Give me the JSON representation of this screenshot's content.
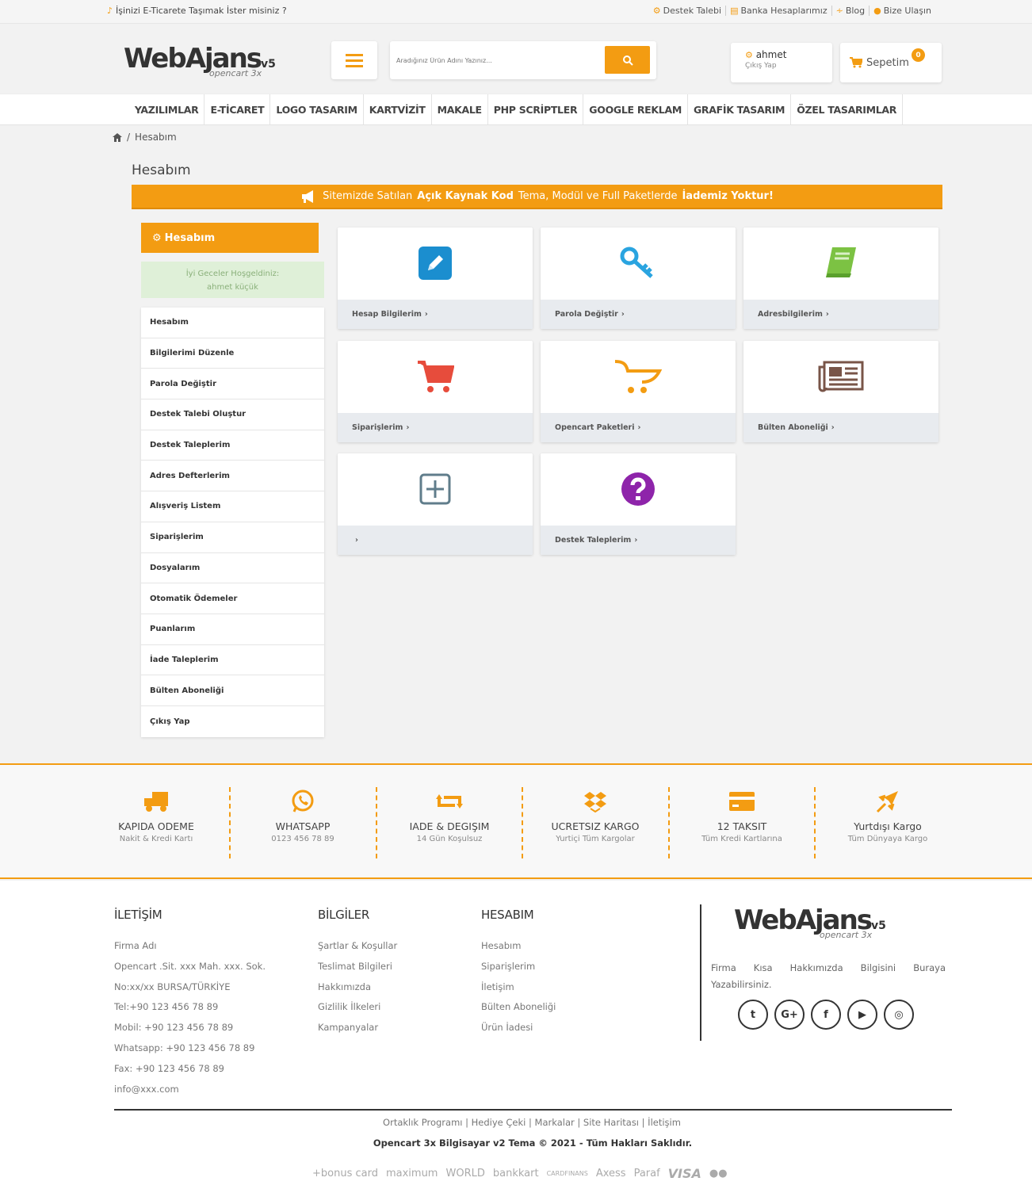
{
  "topbar": {
    "promo": "İşinizi E-Ticarete Taşımak İster misiniz ?",
    "links": [
      "Destek Talebi",
      "Banka Hesaplarımız",
      "Blog",
      "Bize Ulaşın"
    ]
  },
  "header": {
    "logo_main": "WebAjans",
    "logo_version": "v5",
    "logo_sub": "opencart 3x",
    "search_placeholder": "Aradığınız Ürün Adını Yazınız...",
    "account_name": "ahmet",
    "account_sub": "Çıkış Yap",
    "cart_label": "Sepetim",
    "cart_count": "0"
  },
  "nav": [
    "YAZILIMLAR",
    "E-TİCARET",
    "LOGO TASARIM",
    "KARTVİZİT",
    "MAKALE",
    "PHP SCRİPTLER",
    "GOOGLE REKLAM",
    "GRAFİK TASARIM",
    "ÖZEL TASARIMLAR"
  ],
  "breadcrumb": {
    "sep": "/",
    "current": "Hesabım"
  },
  "page_title": "Hesabım",
  "banner": {
    "part1": "Sitemizde Satılan",
    "bold1": "Açık Kaynak Kod",
    "part2": "Tema, Modül ve Full Paketlerde",
    "bold2": "İademiz Yoktur!"
  },
  "sidebar": {
    "title": "Hesabım",
    "welcome_line1": "İyi Geceler Hoşgeldiniz:",
    "welcome_line2": "ahmet küçük",
    "items": [
      "Hesabım",
      "Bilgilerimi Düzenle",
      "Parola Değiştir",
      "Destek Talebi Oluştur",
      "Destek Taleplerim",
      "Adres Defterlerim",
      "Alışveriş Listem",
      "Siparişlerim",
      "Dosyalarım",
      "Otomatik Ödemeler",
      "Puanlarım",
      "İade Taleplerim",
      "Bülten Aboneliği",
      "Çıkış Yap"
    ]
  },
  "cards": [
    {
      "label": "Hesap Bilgilerim",
      "icon": "edit-icon",
      "color": "#1b8ecf"
    },
    {
      "label": "Parola Değiştir",
      "icon": "key-icon",
      "color": "#2aa4e0"
    },
    {
      "label": "Adresbilgilerim",
      "icon": "book-icon",
      "color": "#7cc243"
    },
    {
      "label": "Siparişlerim",
      "icon": "cart-icon",
      "color": "#e74c3c"
    },
    {
      "label": "Opencart Paketleri",
      "icon": "opencart-cart-icon",
      "color": "#f39c12"
    },
    {
      "label": "Bülten Aboneliği",
      "icon": "newspaper-icon",
      "color": "#795548"
    },
    {
      "label": "",
      "icon": "plus-square-icon",
      "color": "#607d8b"
    },
    {
      "label": "Destek Taleplerim",
      "icon": "question-circle-icon",
      "color": "#8e24aa"
    }
  ],
  "features": [
    {
      "title": "KAPIDA ODEME",
      "sub": "Nakit & Kredi Kartı"
    },
    {
      "title": "WHATSAPP",
      "sub": "0123 456 78 89"
    },
    {
      "title": "IADE & DEGIŞIM",
      "sub": "14 Gün Koşulsuz"
    },
    {
      "title": "UCRETSIZ KARGO",
      "sub": "Yurtiçi Tüm Kargolar"
    },
    {
      "title": "12 TAKSIT",
      "sub": "Tüm Kredi Kartlarına"
    },
    {
      "title": "Yurtdışı Kargo",
      "sub": "Tüm Dünyaya Kargo"
    }
  ],
  "footer": {
    "contact_title": "İLETİŞİM",
    "contact": [
      "Firma Adı",
      "Opencart .Sit. xxx Mah. xxx. Sok.",
      "No:xx/xx BURSA/TÜRKİYE",
      "Tel:+90 123 456 78 89",
      "Mobil: +90 123 456 78 89",
      "Whatsapp: +90 123 456 78 89",
      "Fax: +90 123 456 78 89",
      "info@xxx.com"
    ],
    "info_title": "BİLGİLER",
    "info": [
      "Şartlar & Koşullar",
      "Teslimat Bilgileri",
      "Hakkımızda",
      "Gizlilik İlkeleri",
      "Kampanyalar"
    ],
    "account_title": "HESABIM",
    "account": [
      "Hesabım",
      "Siparişlerim",
      "İletişim",
      "Bülten Aboneliği",
      "Ürün İadesi"
    ],
    "description": "Firma Kısa Hakkımızda Bilgisini Buraya Yazabilirsiniz.",
    "social": [
      "twitter-icon",
      "google-plus-icon",
      "facebook-icon",
      "youtube-icon",
      "instagram-icon"
    ],
    "social_glyphs": [
      "t",
      "G+",
      "f",
      "▶",
      "◎"
    ],
    "bottom_links": "Ortaklık Programı |  Hediye Çeki |  Markalar |  Site Haritası |  İletişim",
    "copyright": "Opencart 3x Bilgisayar v2 Tema © 2021 - Tüm Hakları Saklıdır.",
    "payments": [
      "+bonus card",
      "maximum",
      "WORLD",
      "bankkart",
      "CARDFINANS",
      "Axess",
      "Paraf",
      "VISA",
      "●●"
    ]
  },
  "colors": {
    "accent": "#f39c12",
    "welcome_bg": "#dff0d8"
  }
}
